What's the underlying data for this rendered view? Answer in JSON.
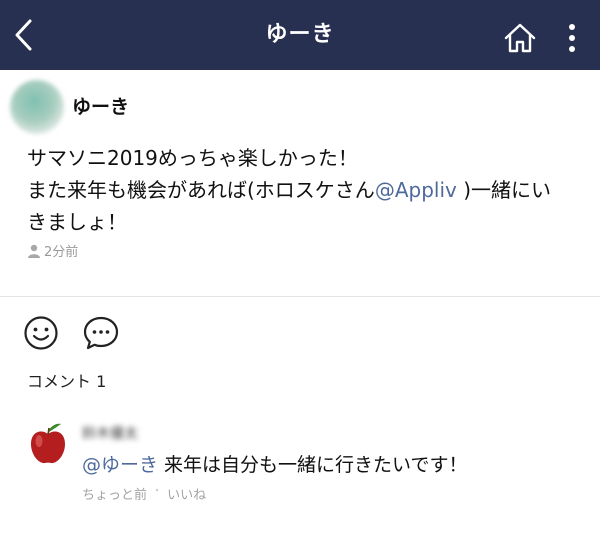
{
  "header": {
    "title": "ゆーき",
    "back_icon": "chevron-left-icon",
    "home_icon": "home-icon",
    "more_icon": "more-vertical-icon",
    "background": "#273050"
  },
  "post": {
    "author": "ゆーき",
    "line1": "サマソニ2019めっちゃ楽しかった！",
    "line2_before": "また来年も機会があれば(ホロスケさん",
    "mention": "@Appliv",
    "line2_after": " )一緒にい",
    "line3": "きましょ！",
    "time": "2分前",
    "time_icon": "person-icon"
  },
  "actions": {
    "like_icon": "smiley-icon",
    "comment_icon": "comment-bubble-icon"
  },
  "comments": {
    "count_label": "コメント 1",
    "items": [
      {
        "author": "鈴木優太",
        "mention": "@ゆーき",
        "text": " 来年は自分も一緒に行きたいです！",
        "time": "ちょっと前",
        "separator": "·",
        "like_label": "いいね",
        "avatar_icon": "apple-icon"
      }
    ]
  },
  "colors": {
    "mention": "#4e6a9c",
    "meta": "#9a9a9a"
  }
}
